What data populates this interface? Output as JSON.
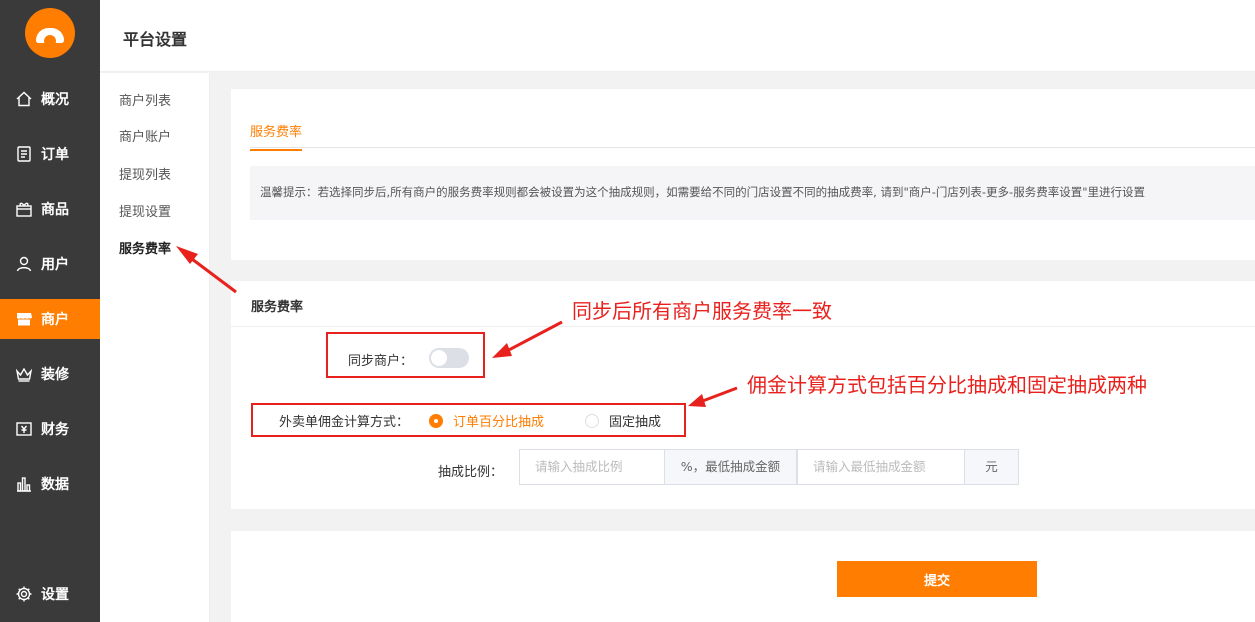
{
  "sidebar": {
    "items": [
      {
        "label": "概况",
        "icon": "home-icon"
      },
      {
        "label": "订单",
        "icon": "order-icon"
      },
      {
        "label": "商品",
        "icon": "goods-icon"
      },
      {
        "label": "用户",
        "icon": "user-icon"
      },
      {
        "label": "商户",
        "icon": "store-icon",
        "active": true
      },
      {
        "label": "装修",
        "icon": "crown-icon"
      },
      {
        "label": "财务",
        "icon": "finance-icon"
      },
      {
        "label": "数据",
        "icon": "chart-icon"
      }
    ],
    "settings": {
      "label": "设置",
      "icon": "gear-icon"
    },
    "accent": "#ff7d00",
    "bg": "#3a3a3a"
  },
  "header": {
    "title": "平台设置"
  },
  "subnav": {
    "items": [
      "商户列表",
      "商户账户",
      "提现列表",
      "提现设置",
      "服务费率"
    ],
    "active_index": 4
  },
  "tab": {
    "label": "服务费率"
  },
  "tip": {
    "text": "温馨提示：若选择同步后,所有商户的服务费率规则都会被设置为这个抽成规则，如需要给不同的门店设置不同的抽成费率, 请到\"商户-门店列表-更多-服务费率设置\"里进行设置"
  },
  "form": {
    "section_title": "服务费率",
    "sync_label": "同步商户：",
    "sync_enabled": false,
    "commission_label": "外卖单佣金计算方式：",
    "commission_options": [
      "订单百分比抽成",
      "固定抽成"
    ],
    "commission_selected": "订单百分比抽成",
    "ratio_label": "抽成比例：",
    "ratio_placeholder": "请输入抽成比例",
    "ratio_append": "%，最低抽成金额",
    "min_placeholder": "请输入最低抽成金额",
    "min_append": "元",
    "submit_label": "提交"
  },
  "annotations": {
    "note1": "同步后所有商户服务费率一致",
    "note2": "佣金计算方式包括百分比抽成和固定抽成两种",
    "color": "#e8211d"
  }
}
